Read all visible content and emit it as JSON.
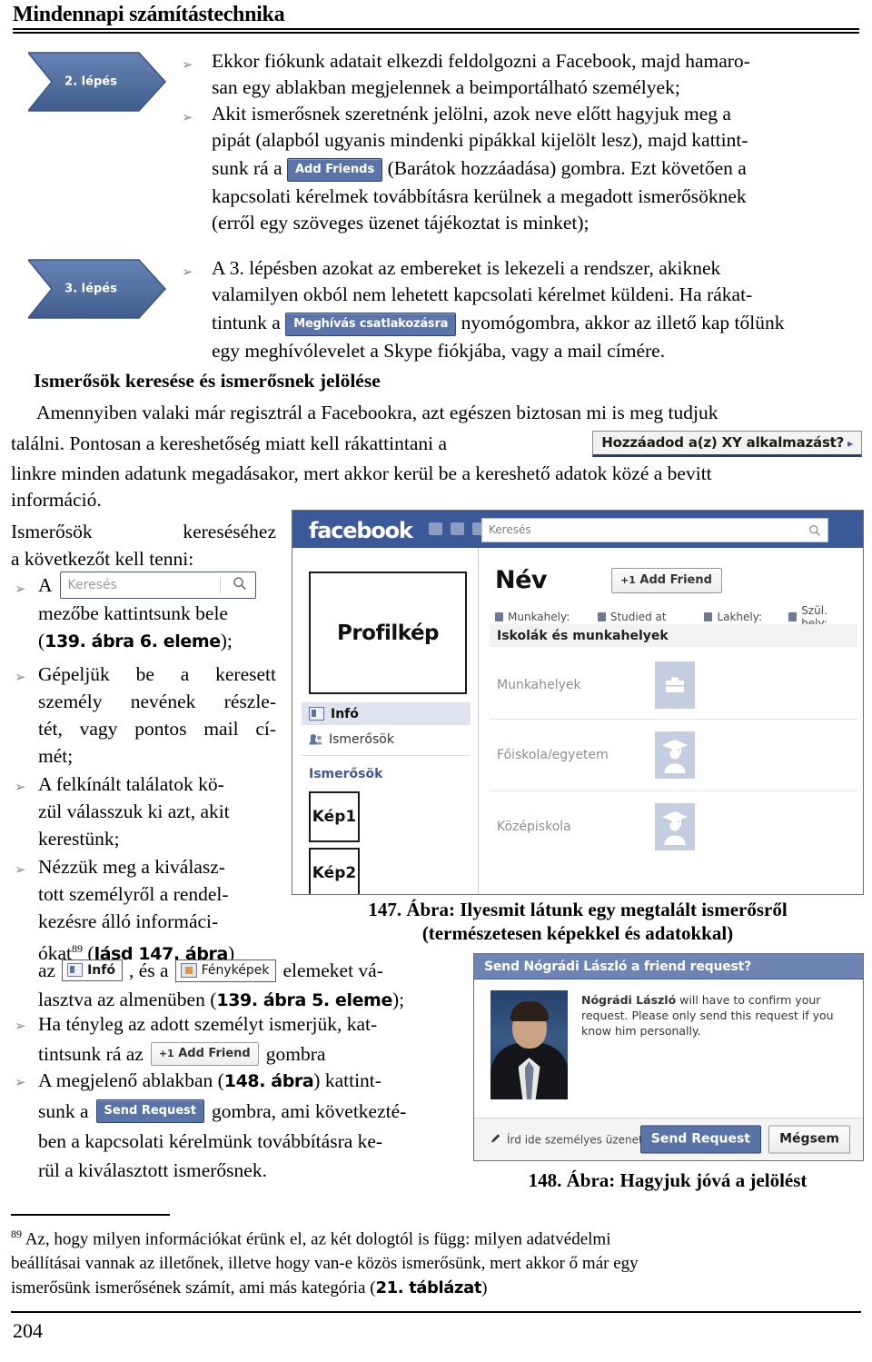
{
  "header": {
    "title": "Mindennapi számítástechnika"
  },
  "steps": {
    "step2": "2. lépés",
    "step3": "3. lépés"
  },
  "bullets": {
    "b1_line1": "Ekkor fiókunk adatait elkezdi feldolgozni a Facebook, majd hamaro-",
    "b1_line2": "san egy ablakban megjelennek a beimportálható személyek;",
    "b2_line1": "Akit ismerősnek szeretnénk jelölni, azok neve előtt hagyjuk meg a",
    "b2_line2": "pipát (alapból ugyanis mindenki pipákkal kijelölt lesz), majd kattint-",
    "b2_line3_pre": "sunk rá a",
    "b2_chip": "Add Friends",
    "b2_line3_post": "(Barátok hozzáadása) gombra. Ezt követően a",
    "b2_line4": "kapcsolati kérelmek továbbításra kerülnek a megadott ismerősöknek",
    "b2_line5": "(erről egy szöveges üzenet tájékoztat is minket);",
    "b3_line1": "A 3. lépésben azokat az embereket is lekezeli a rendszer, akiknek",
    "b3_line2": "valamilyen okból nem lehetett kapcsolati kérelmet küldeni. Ha rákat-",
    "b3_line3_pre": "tintunk a",
    "b3_chip": "Meghívás csatlakozásra",
    "b3_line3_post": "nyomógombra, akkor az illető kap tőlünk",
    "b3_line4": "egy meghívólevelet a Skype fiókjába, vagy a mail címére."
  },
  "section": {
    "heading": "Ismerősök keresése és ismerősnek jelölése",
    "p1_line1": "Amennyiben valaki már regisztrál a Facebookra, azt egészen biztosan mi is meg tudjuk",
    "p1_line2_pre": "találni. Pontosan a kereshetőség miatt kell rákattintani a",
    "p1_chip": "Hozzáadod a(z) XY alkalmazást?",
    "p1_chip_caret": "▸",
    "p1_line3": "linkre minden adatunk megadásakor, mert akkor kerül be a kereshető adatok közé a bevitt",
    "p1_line4": "információ."
  },
  "leftlist": {
    "intro_line1": "Ismerősök keresésé­hez",
    "intro_line1_txt": "Ismerősök        keresé­séhez",
    "intro_line2": "a következőt kell tenni:",
    "i1_pre": "A",
    "i1_search_placeholder": "Keresés",
    "i1_line2": "mezőbe kattintsunk bele",
    "i1_ref_open": "(",
    "i1_ref": "139. ábra 6. eleme",
    "i1_ref_close": ");",
    "i2_line1": "Gépeljük be a keresett",
    "i2_line2": "személy nevének részle-",
    "i2_line3": "tét, vagy pontos mail cí-",
    "i2_line4": "mét;",
    "i3_line1": "A felkínált találatok kö-",
    "i3_line2": "zül válasszuk ki azt, akit",
    "i3_line3": "kerestünk;",
    "i4_line1": "Nézzük meg a kiválasz-",
    "i4_line2": "tott személyről a rendel-",
    "i4_line3": "kezésre álló informáci-",
    "i4_line4_pre": "ókat",
    "i4_footnote_mark": "89",
    "i4_line4_ref_open": " (",
    "i4_line4_ref": "lásd 147. ábra",
    "i4_line4_ref_close": ")",
    "i5_pre": "az",
    "i5_chip_info": "Infó",
    "i5_mid": ", és a",
    "i5_chip_photo": "Fényképek",
    "i5_post": "elemeket vá-",
    "i5_line2_pre": "lasztva az almenüben (",
    "i5_line2_ref": "139. ábra 5. eleme",
    "i5_line2_post": ");",
    "i6_line1": "Ha tényleg az adott személyt ismerjük, kat-",
    "i6_line2_pre": "tintsunk rá az",
    "i6_chip_plus": "+1",
    "i6_chip": "Add Friend",
    "i6_line2_post": "gombra",
    "i7_line1_pre": "A megjelenő ablakban (",
    "i7_line1_ref": "148. ábra",
    "i7_line1_post": ") kattint-",
    "i7_line2_pre": "sunk a",
    "i7_chip": "Send Request",
    "i7_line2_post": "gombra, ami következté-",
    "i7_line3": "ben a kapcsolati kérelmünk továbbításra ke-",
    "i7_line4": "rül a kiválasztott ismerősnek."
  },
  "fig147": {
    "logo": "facebook",
    "search_placeholder": "Keresés",
    "profile_pic_label": "Profilkép",
    "nav": [
      {
        "label": "Infó",
        "selected": true
      },
      {
        "label": "Ismerősök",
        "selected": false
      }
    ],
    "friends_section_title": "Ismerősök",
    "thumbs": [
      "Kép1",
      "Kép2"
    ],
    "name": "Név",
    "add_friend_plus": "+1",
    "add_friend_label": "Add Friend",
    "meta": [
      "Munkahely:",
      "Studied at",
      "Lakhely:",
      "Szül. hely:"
    ],
    "band_title": "Iskolák és munkahelyek",
    "rows": [
      "Munkahelyek",
      "Főiskola/egyetem",
      "Középiskola"
    ],
    "caption_line1": "147. Ábra: Ilyesmit látunk egy megtalált ismerősről",
    "caption_line2": "(természetesen képekkel és adatokkal)"
  },
  "fig148": {
    "title": "Send Nógrádi László a friend request?",
    "body_bold": "Nógrádi László",
    "body_rest": " will have to confirm your request. Please only send this request if you know him personally.",
    "message_placeholder": "Írd ide személyes üzeneted:",
    "btn_send": "Send Request",
    "btn_cancel": "Mégsem",
    "caption": "148. Ábra: Hagyjuk jóvá a jelölést"
  },
  "footnote": {
    "mark": "89",
    "line1": "Az, hogy milyen információkat érünk el, az két dologtól is függ: milyen adatvédelmi",
    "line2": "beállításai vannak az illetőnek, illetve hogy van-e közös ismerősünk, mert akkor ő már egy",
    "line3_pre": "ismerősünk ismerősének számít, ami más kategória (",
    "line3_ref": "21. táblázat",
    "line3_post": ")"
  },
  "page_number": "204",
  "colors": {
    "fb_blue": "#3b5998",
    "fb_button_blue": "#5b74a8",
    "step_shape": "#4f6fa8",
    "bullet_grey": "#8a8a8a"
  }
}
